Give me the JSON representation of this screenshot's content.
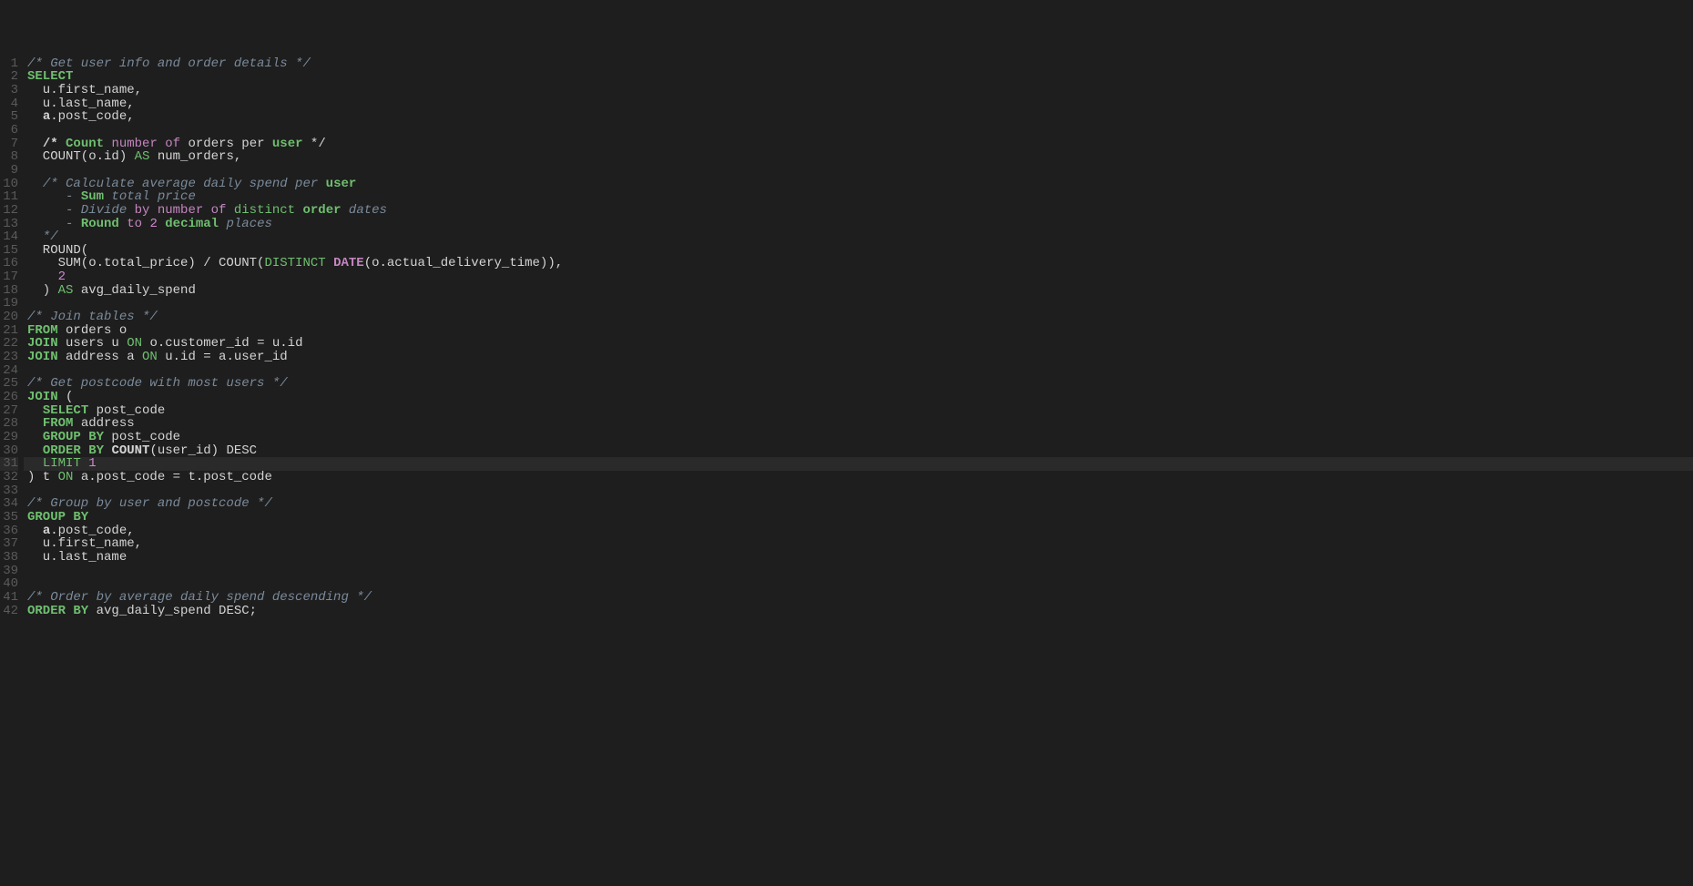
{
  "editor": {
    "highlighted_line": 31,
    "lines": [
      {
        "num": 1,
        "tokens": [
          [
            "c-comment",
            "/* Get user info and order details */"
          ]
        ]
      },
      {
        "num": 2,
        "tokens": [
          [
            "c-keyword-b",
            "SELECT"
          ]
        ]
      },
      {
        "num": 3,
        "tokens": [
          [
            "",
            "  u.first_name,"
          ]
        ]
      },
      {
        "num": 4,
        "tokens": [
          [
            "",
            "  u.last_name,"
          ]
        ]
      },
      {
        "num": 5,
        "tokens": [
          [
            "",
            "  "
          ],
          [
            "c-bold",
            "a"
          ],
          [
            "",
            ".post_code,"
          ]
        ]
      },
      {
        "num": 6,
        "tokens": [
          [
            "",
            ""
          ]
        ]
      },
      {
        "num": 7,
        "tokens": [
          [
            "",
            "  "
          ],
          [
            "c-bold",
            "/* "
          ],
          [
            "c-keyword-b",
            "Count "
          ],
          [
            "c-word",
            "number "
          ],
          [
            "c-op",
            "of "
          ],
          [
            "",
            "orders per "
          ],
          [
            "c-keyword-b",
            "user "
          ],
          [
            "",
            "*/"
          ]
        ]
      },
      {
        "num": 8,
        "tokens": [
          [
            "",
            "  COUNT(o.id) "
          ],
          [
            "c-keyword",
            "AS "
          ],
          [
            "",
            "num_orders,"
          ]
        ]
      },
      {
        "num": 9,
        "tokens": [
          [
            "",
            ""
          ]
        ]
      },
      {
        "num": 10,
        "tokens": [
          [
            "",
            "  "
          ],
          [
            "c-comment",
            "/* Calculate average daily spend per "
          ],
          [
            "c-keyword-b",
            "user"
          ]
        ]
      },
      {
        "num": 11,
        "tokens": [
          [
            "c-comment",
            "     - "
          ],
          [
            "c-keyword-b",
            "Sum"
          ],
          [
            "c-comment",
            " total price"
          ]
        ]
      },
      {
        "num": 12,
        "tokens": [
          [
            "c-comment",
            "     - Divide "
          ],
          [
            "c-op",
            "by "
          ],
          [
            "c-word",
            "number "
          ],
          [
            "c-op",
            "of "
          ],
          [
            "c-keyword",
            "distinct "
          ],
          [
            "c-keyword-b",
            "order "
          ],
          [
            "c-comment",
            "dates"
          ]
        ]
      },
      {
        "num": 13,
        "tokens": [
          [
            "c-comment",
            "     - "
          ],
          [
            "c-keyword-b",
            "Round "
          ],
          [
            "c-op",
            "to "
          ],
          [
            "c-num",
            "2 "
          ],
          [
            "c-keyword-b",
            "decimal "
          ],
          [
            "c-comment",
            "places"
          ]
        ]
      },
      {
        "num": 14,
        "tokens": [
          [
            "c-comment",
            "  */"
          ]
        ]
      },
      {
        "num": 15,
        "tokens": [
          [
            "",
            "  ROUND("
          ]
        ]
      },
      {
        "num": 16,
        "tokens": [
          [
            "",
            "    SUM(o.total_price) / COUNT("
          ],
          [
            "c-distinct",
            "DISTINCT "
          ],
          [
            "c-date",
            "DATE"
          ],
          [
            "",
            "(o.actual_delivery_time)),"
          ]
        ]
      },
      {
        "num": 17,
        "tokens": [
          [
            "",
            "    "
          ],
          [
            "c-num",
            "2"
          ]
        ]
      },
      {
        "num": 18,
        "tokens": [
          [
            "",
            "  ) "
          ],
          [
            "c-keyword",
            "AS"
          ],
          [
            "",
            " avg_daily_spend"
          ]
        ]
      },
      {
        "num": 19,
        "tokens": [
          [
            "",
            ""
          ]
        ]
      },
      {
        "num": 20,
        "tokens": [
          [
            "c-comment",
            "/* Join tables */"
          ]
        ]
      },
      {
        "num": 21,
        "tokens": [
          [
            "c-keyword-b",
            "FROM"
          ],
          [
            "",
            " orders o"
          ]
        ]
      },
      {
        "num": 22,
        "tokens": [
          [
            "c-keyword-b",
            "JOIN"
          ],
          [
            "",
            " users u "
          ],
          [
            "c-keyword",
            "ON"
          ],
          [
            "",
            " o.customer_id = u.id"
          ]
        ]
      },
      {
        "num": 23,
        "tokens": [
          [
            "c-keyword-b",
            "JOIN"
          ],
          [
            "",
            " address a "
          ],
          [
            "c-keyword",
            "ON"
          ],
          [
            "",
            " u.id = a.user_id"
          ]
        ]
      },
      {
        "num": 24,
        "tokens": [
          [
            "",
            ""
          ]
        ]
      },
      {
        "num": 25,
        "tokens": [
          [
            "c-comment",
            "/* Get postcode with most users */"
          ]
        ]
      },
      {
        "num": 26,
        "tokens": [
          [
            "c-keyword-b",
            "JOIN"
          ],
          [
            "",
            " ("
          ]
        ]
      },
      {
        "num": 27,
        "tokens": [
          [
            "",
            "  "
          ],
          [
            "c-keyword-b",
            "SELECT"
          ],
          [
            "",
            " post_code"
          ]
        ]
      },
      {
        "num": 28,
        "tokens": [
          [
            "",
            "  "
          ],
          [
            "c-keyword-b",
            "FROM"
          ],
          [
            "",
            " address"
          ]
        ]
      },
      {
        "num": 29,
        "tokens": [
          [
            "",
            "  "
          ],
          [
            "c-keyword-b",
            "GROUP BY"
          ],
          [
            "",
            " post_code"
          ]
        ]
      },
      {
        "num": 30,
        "tokens": [
          [
            "",
            "  "
          ],
          [
            "c-keyword-b",
            "ORDER BY"
          ],
          [
            "",
            " "
          ],
          [
            "c-bold",
            "COUNT"
          ],
          [
            "",
            "(user_id) DESC"
          ]
        ]
      },
      {
        "num": 31,
        "tokens": [
          [
            "",
            "  "
          ],
          [
            "c-keyword",
            "LIMIT "
          ],
          [
            "c-num",
            "1"
          ]
        ]
      },
      {
        "num": 32,
        "tokens": [
          [
            "",
            ") t "
          ],
          [
            "c-keyword",
            "ON"
          ],
          [
            "",
            " a.post_code = t.post_code"
          ]
        ]
      },
      {
        "num": 33,
        "tokens": [
          [
            "",
            ""
          ]
        ]
      },
      {
        "num": 34,
        "tokens": [
          [
            "c-comment",
            "/* Group by user and postcode */"
          ]
        ]
      },
      {
        "num": 35,
        "tokens": [
          [
            "c-keyword-b",
            "GROUP BY"
          ]
        ]
      },
      {
        "num": 36,
        "tokens": [
          [
            "",
            "  "
          ],
          [
            "c-bold",
            "a"
          ],
          [
            "",
            ".post_code,"
          ]
        ]
      },
      {
        "num": 37,
        "tokens": [
          [
            "",
            "  u.first_name,"
          ]
        ]
      },
      {
        "num": 38,
        "tokens": [
          [
            "",
            "  u.last_name"
          ]
        ]
      },
      {
        "num": 39,
        "tokens": [
          [
            "",
            ""
          ]
        ]
      },
      {
        "num": 40,
        "tokens": [
          [
            "",
            ""
          ]
        ]
      },
      {
        "num": 41,
        "tokens": [
          [
            "c-comment",
            "/* Order by average daily spend descending */"
          ]
        ]
      },
      {
        "num": 42,
        "tokens": [
          [
            "c-keyword-b",
            "ORDER BY"
          ],
          [
            "",
            " avg_daily_spend DESC;"
          ]
        ]
      }
    ]
  }
}
